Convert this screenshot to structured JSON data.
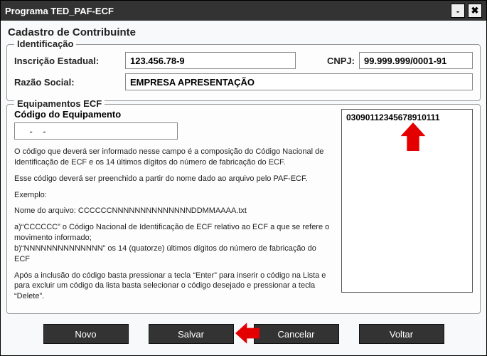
{
  "window": {
    "title": "Programa TED_PAF-ECF"
  },
  "heading": "Cadastro de Contribuinte",
  "identificacao": {
    "legend": "Identificação",
    "inscricao_label": "Inscrição Estadual:",
    "inscricao_value": "123.456.78-9",
    "cnpj_label": "CNPJ:",
    "cnpj_value": "99.999.999/0001-91",
    "razao_label": "Razão Social:",
    "razao_value": "EMPRESA APRESENTAÇÃO"
  },
  "equip": {
    "legend": "Equipamentos ECF",
    "code_label": "Código do Equipamento",
    "code_value": "    -    -",
    "list_item": "03090112345678910111",
    "help_p1": "O código que deverá ser informado nesse campo é a composição do Código Nacional de Identificação de ECF e os 14 últimos dígitos do número de fabricação do ECF.",
    "help_p2": "Esse código deverá ser preenchido a partir do nome dado ao arquivo pelo PAF-ECF.",
    "help_p3": "Exemplo:",
    "help_p4": "Nome do arquivo: CCCCCCNNNNNNNNNNNNNNDDMMAAAA.txt",
    "help_p5a": "a)“CCCCCC” o Código Nacional de Identificação de ECF relativo ao ECF a que se refere o movimento informado;",
    "help_p5b": "b)“NNNNNNNNNNNNNN” os 14 (quatorze) últimos dígitos do número de fabricação do ECF",
    "help_p6": "Após a inclusão do código basta pressionar a tecla “Enter” para inserir o código na Lista e para excluir um código da lista basta selecionar o código desejado e pressionar a tecla “Delete”."
  },
  "buttons": {
    "novo": "Novo",
    "salvar": "Salvar",
    "cancelar": "Cancelar",
    "voltar": "Voltar"
  },
  "icons": {
    "minimize": "-",
    "close": "✖"
  }
}
